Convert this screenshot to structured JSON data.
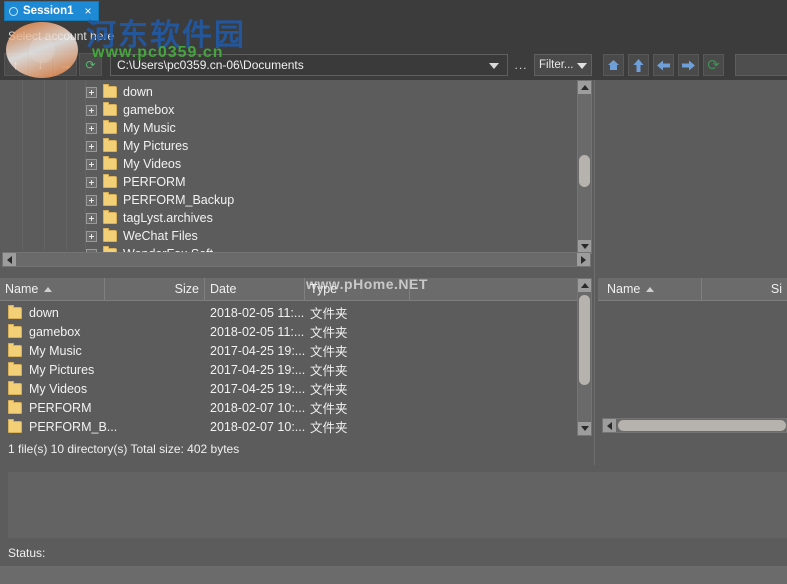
{
  "window": {
    "accent_color": "#1e8ad6",
    "background_color": "#5c5c5c",
    "panel_color": "#3c3c3c"
  },
  "tabs": [
    {
      "label": "Session1",
      "close_label": "×",
      "status_icon": "circle-status-icon",
      "active": true
    }
  ],
  "account": {
    "placeholder": "Select account here",
    "value": "Select account here"
  },
  "toolbar_left": {
    "buttons": [
      {
        "name": "up-button",
        "glyph": "↑"
      },
      {
        "name": "download-button",
        "glyph": "↓"
      },
      {
        "name": "forward-button",
        "glyph": "→"
      },
      {
        "name": "refresh-button",
        "glyph": "⟳"
      }
    ],
    "path_value": "C:\\Users\\pc0359.cn-06\\Documents",
    "dots_label": "...",
    "filter_label": "Filter..."
  },
  "toolbar_right": {
    "buttons": [
      {
        "name": "home-button",
        "glyph": "⌂"
      },
      {
        "name": "up-button",
        "glyph": "↑"
      },
      {
        "name": "back-button",
        "glyph": "←"
      },
      {
        "name": "forward-button",
        "glyph": "→"
      },
      {
        "name": "refresh-button",
        "glyph": "⟳"
      }
    ],
    "field_value": ""
  },
  "tree": {
    "items": [
      {
        "label": "down"
      },
      {
        "label": "gamebox"
      },
      {
        "label": "My Music"
      },
      {
        "label": "My Pictures"
      },
      {
        "label": "My Videos"
      },
      {
        "label": "PERFORM"
      },
      {
        "label": "PERFORM_Backup"
      },
      {
        "label": "tagLyst.archives"
      },
      {
        "label": "WeChat Files"
      },
      {
        "label": "WonderFox Soft"
      }
    ]
  },
  "local_list": {
    "columns": [
      {
        "label": "Name",
        "sort": "asc"
      },
      {
        "label": "Size",
        "sort": ""
      },
      {
        "label": "Date",
        "sort": ""
      },
      {
        "label": "Type",
        "sort": ""
      }
    ],
    "rows": [
      {
        "name": "down",
        "size": "",
        "date": "2018-02-05 11:...",
        "type": "文件夹"
      },
      {
        "name": "gamebox",
        "size": "",
        "date": "2018-02-05 11:...",
        "type": "文件夹"
      },
      {
        "name": "My Music",
        "size": "",
        "date": "2017-04-25 19:...",
        "type": "文件夹"
      },
      {
        "name": "My Pictures",
        "size": "",
        "date": "2017-04-25 19:...",
        "type": "文件夹"
      },
      {
        "name": "My Videos",
        "size": "",
        "date": "2017-04-25 19:...",
        "type": "文件夹"
      },
      {
        "name": "PERFORM",
        "size": "",
        "date": "2018-02-07 10:...",
        "type": "文件夹"
      },
      {
        "name": "PERFORM_B...",
        "size": "",
        "date": "2018-02-07 10:...",
        "type": "文件夹"
      }
    ],
    "summary": "1 file(s)  10 directory(s) Total size: 402 bytes"
  },
  "remote_list": {
    "columns": [
      {
        "label": "Name",
        "sort": "asc"
      },
      {
        "label": "Si",
        "sort": ""
      }
    ],
    "rows": []
  },
  "statusbar": {
    "label": "Status:"
  },
  "watermarks": {
    "chinese": "河东软件园",
    "url": "www.pc0359.cn",
    "phome": "www.pHome.NET"
  }
}
